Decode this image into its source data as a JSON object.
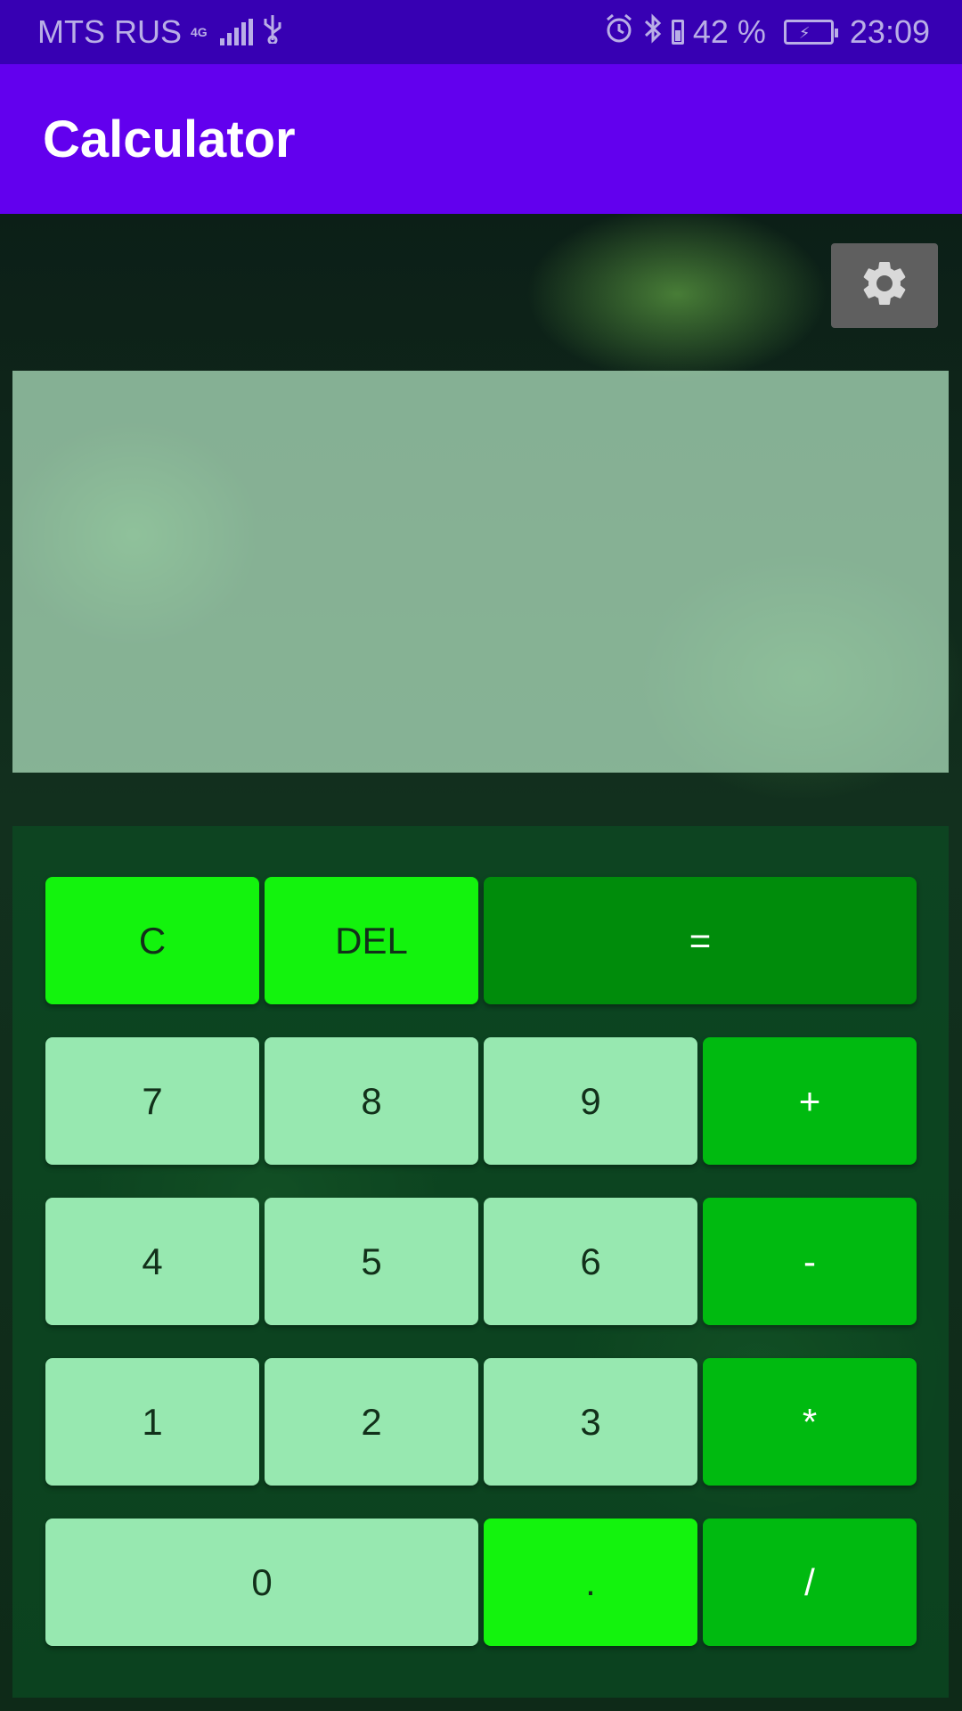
{
  "status_bar": {
    "carrier": "MTS RUS",
    "network": "4G",
    "battery_percent": "42 %",
    "time": "23:09"
  },
  "app_bar": {
    "title": "Calculator"
  },
  "settings": {
    "icon": "gear-icon"
  },
  "display": {
    "value": ""
  },
  "keys": {
    "clear": "C",
    "delete": "DEL",
    "equals": "=",
    "seven": "7",
    "eight": "8",
    "nine": "9",
    "plus": "+",
    "four": "4",
    "five": "5",
    "six": "6",
    "minus": "-",
    "one": "1",
    "two": "2",
    "three": "3",
    "multiply": "*",
    "zero": "0",
    "dot": ".",
    "divide": "/"
  },
  "colors": {
    "status_bar": "#3700b3",
    "app_bar": "#6200ee",
    "key_number": "#97e8b0",
    "key_bright": "#13f30d",
    "key_equals": "#008c0b",
    "key_operator": "#00ba10"
  }
}
